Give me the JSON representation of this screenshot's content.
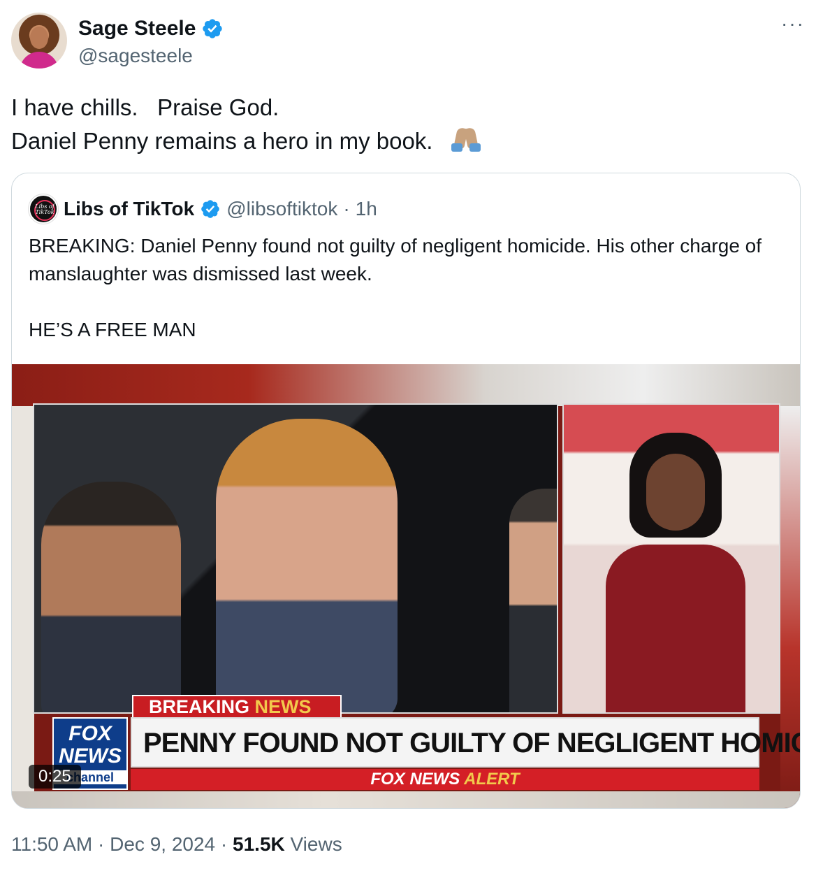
{
  "author": {
    "name": "Sage Steele",
    "handle": "@sagesteele",
    "verified_icon": "verified-badge-icon"
  },
  "menu": {
    "more_label": "···"
  },
  "tweet": {
    "text": "I have chills.   Praise God.\nDaniel Penny remains a hero in my book.  ",
    "emoji": "folded-hands-emoji"
  },
  "quoted": {
    "avatar_text": "Libs of TikTok",
    "name": "Libs of TikTok",
    "handle": "@libsoftiktok",
    "separator": "·",
    "time": "1h",
    "text": "BREAKING: Daniel Penny found not guilty of negligent homicide. His other charge of manslaughter was dismissed last week.\n\nHE’S A FREE MAN",
    "media": {
      "duration": "0:25",
      "breaking_word": "BREAKING",
      "news_word": "NEWS",
      "logo_line1": "FOX",
      "logo_line2": "NEWS",
      "logo_line3": "channel",
      "headline": "PENNY FOUND NOT GUILTY OF NEGLIGENT HOMICIDE",
      "alert_part1": "FOX NEWS",
      "alert_part2": "ALERT"
    }
  },
  "footer": {
    "time": "11:50 AM",
    "sep1": "·",
    "date": "Dec 9, 2024",
    "sep2": "·",
    "views_count": "51.5K",
    "views_label": "Views"
  },
  "colors": {
    "verified": "#1d9bf0",
    "secondary_text": "#536471",
    "border": "#cfd9de"
  }
}
